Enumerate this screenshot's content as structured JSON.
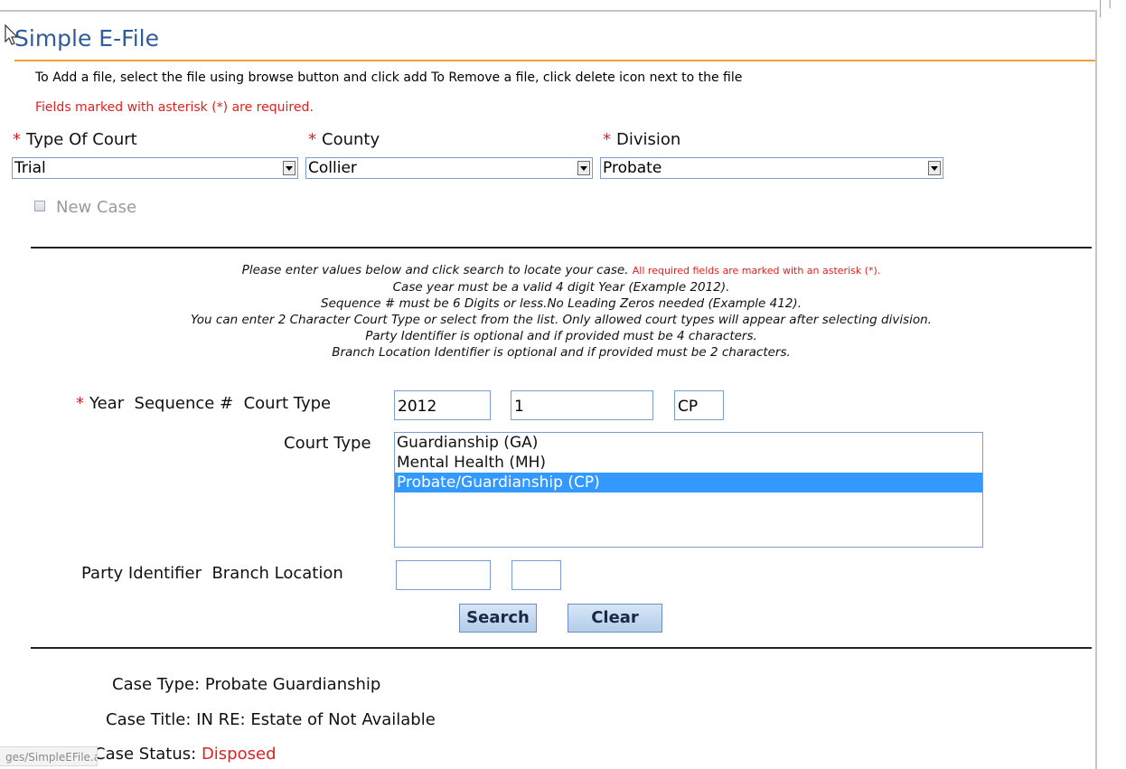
{
  "page": {
    "title": "Simple E-File",
    "instructions": "To Add a file, select the file using browse button and click add To Remove a file, click delete icon next to the file",
    "required_note": "Fields marked with asterisk (*) are required."
  },
  "court_selectors": {
    "asterisk": "*",
    "type_of_court": {
      "label": "Type Of Court",
      "value": "Trial"
    },
    "county": {
      "label": "County",
      "value": "Collier"
    },
    "division": {
      "label": "Division",
      "value": "Probate"
    }
  },
  "new_case": {
    "label": "New Case",
    "checked": false,
    "disabled": true
  },
  "help": {
    "line1_main": "Please enter values below and click search to locate your case.",
    "line1_red": "All required fields are marked with an asterisk (*).",
    "line2": "Case year must be a valid 4 digit Year (Example 2012).",
    "line3": "Sequence # must be 6 Digits or less.No Leading Zeros needed (Example 412).",
    "line4": "You can enter 2 Character Court Type or select from the list. Only allowed court types will appear after selecting division.",
    "line5": "Party Identifier is optional and if provided must be 4 characters.",
    "line6": "Branch Location Identifier is optional and if provided must be 2 characters."
  },
  "case_number": {
    "asterisk": "*",
    "label": "Year  Sequence #  Court Type",
    "year": "2012",
    "sequence": "1",
    "court_type": "CP"
  },
  "court_type_list": {
    "label": "Court Type",
    "options": [
      "Guardianship (GA)",
      "Mental Health (MH)",
      "Probate/Guardianship (CP)"
    ],
    "selected_index": 2
  },
  "party_branch": {
    "label": "Party Identifier  Branch Location",
    "party_identifier": "",
    "branch_location": ""
  },
  "buttons": {
    "search": "Search",
    "clear": "Clear"
  },
  "case_info": {
    "case_type_label": "Case Type:",
    "case_type_value": "Probate Guardianship",
    "case_title_label": "Case Title:",
    "case_title_value": "IN RE: Estate of Not Available",
    "case_status_label": "Case Status:",
    "case_status_value": "Disposed"
  },
  "statusbar": {
    "text": "ges/SimpleEFile.aspx"
  },
  "colors": {
    "title_blue": "#2f5b9b",
    "accent_orange": "#f0a030",
    "required_red": "#e02020",
    "selection_blue": "#3399ff"
  }
}
